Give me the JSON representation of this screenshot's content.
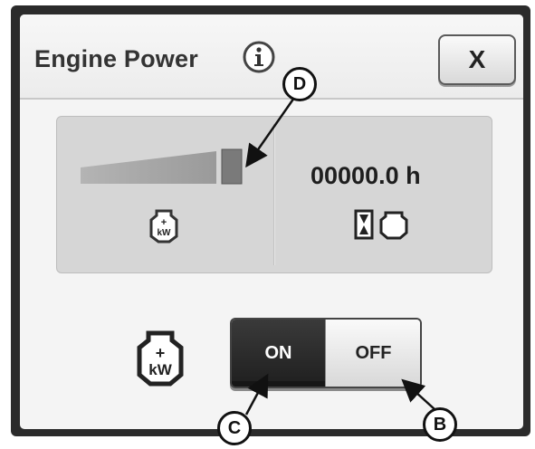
{
  "dialog": {
    "title": "Engine Power",
    "info_icon": "info-icon",
    "close_label": "X"
  },
  "status_panel": {
    "power_level_fraction": 0.92,
    "power_icon": "engine-power-kw-icon",
    "hours_value": "00000.0 h",
    "hours_icons": [
      "hourglass-icon",
      "engine-icon"
    ],
    "kw_label": "kW",
    "plus_label": "+"
  },
  "control": {
    "icon": "engine-power-kw-icon",
    "kw_label": "kW",
    "plus_label": "+",
    "on_label": "ON",
    "off_label": "OFF",
    "selected": "ON"
  },
  "callouts": {
    "d": "D",
    "c": "C",
    "b": "B"
  },
  "colors": {
    "frame": "#2b2b2b",
    "panel": "#d6d6d6",
    "toggle_on_bg": "#262626",
    "toggle_off_bg": "#ececec"
  }
}
